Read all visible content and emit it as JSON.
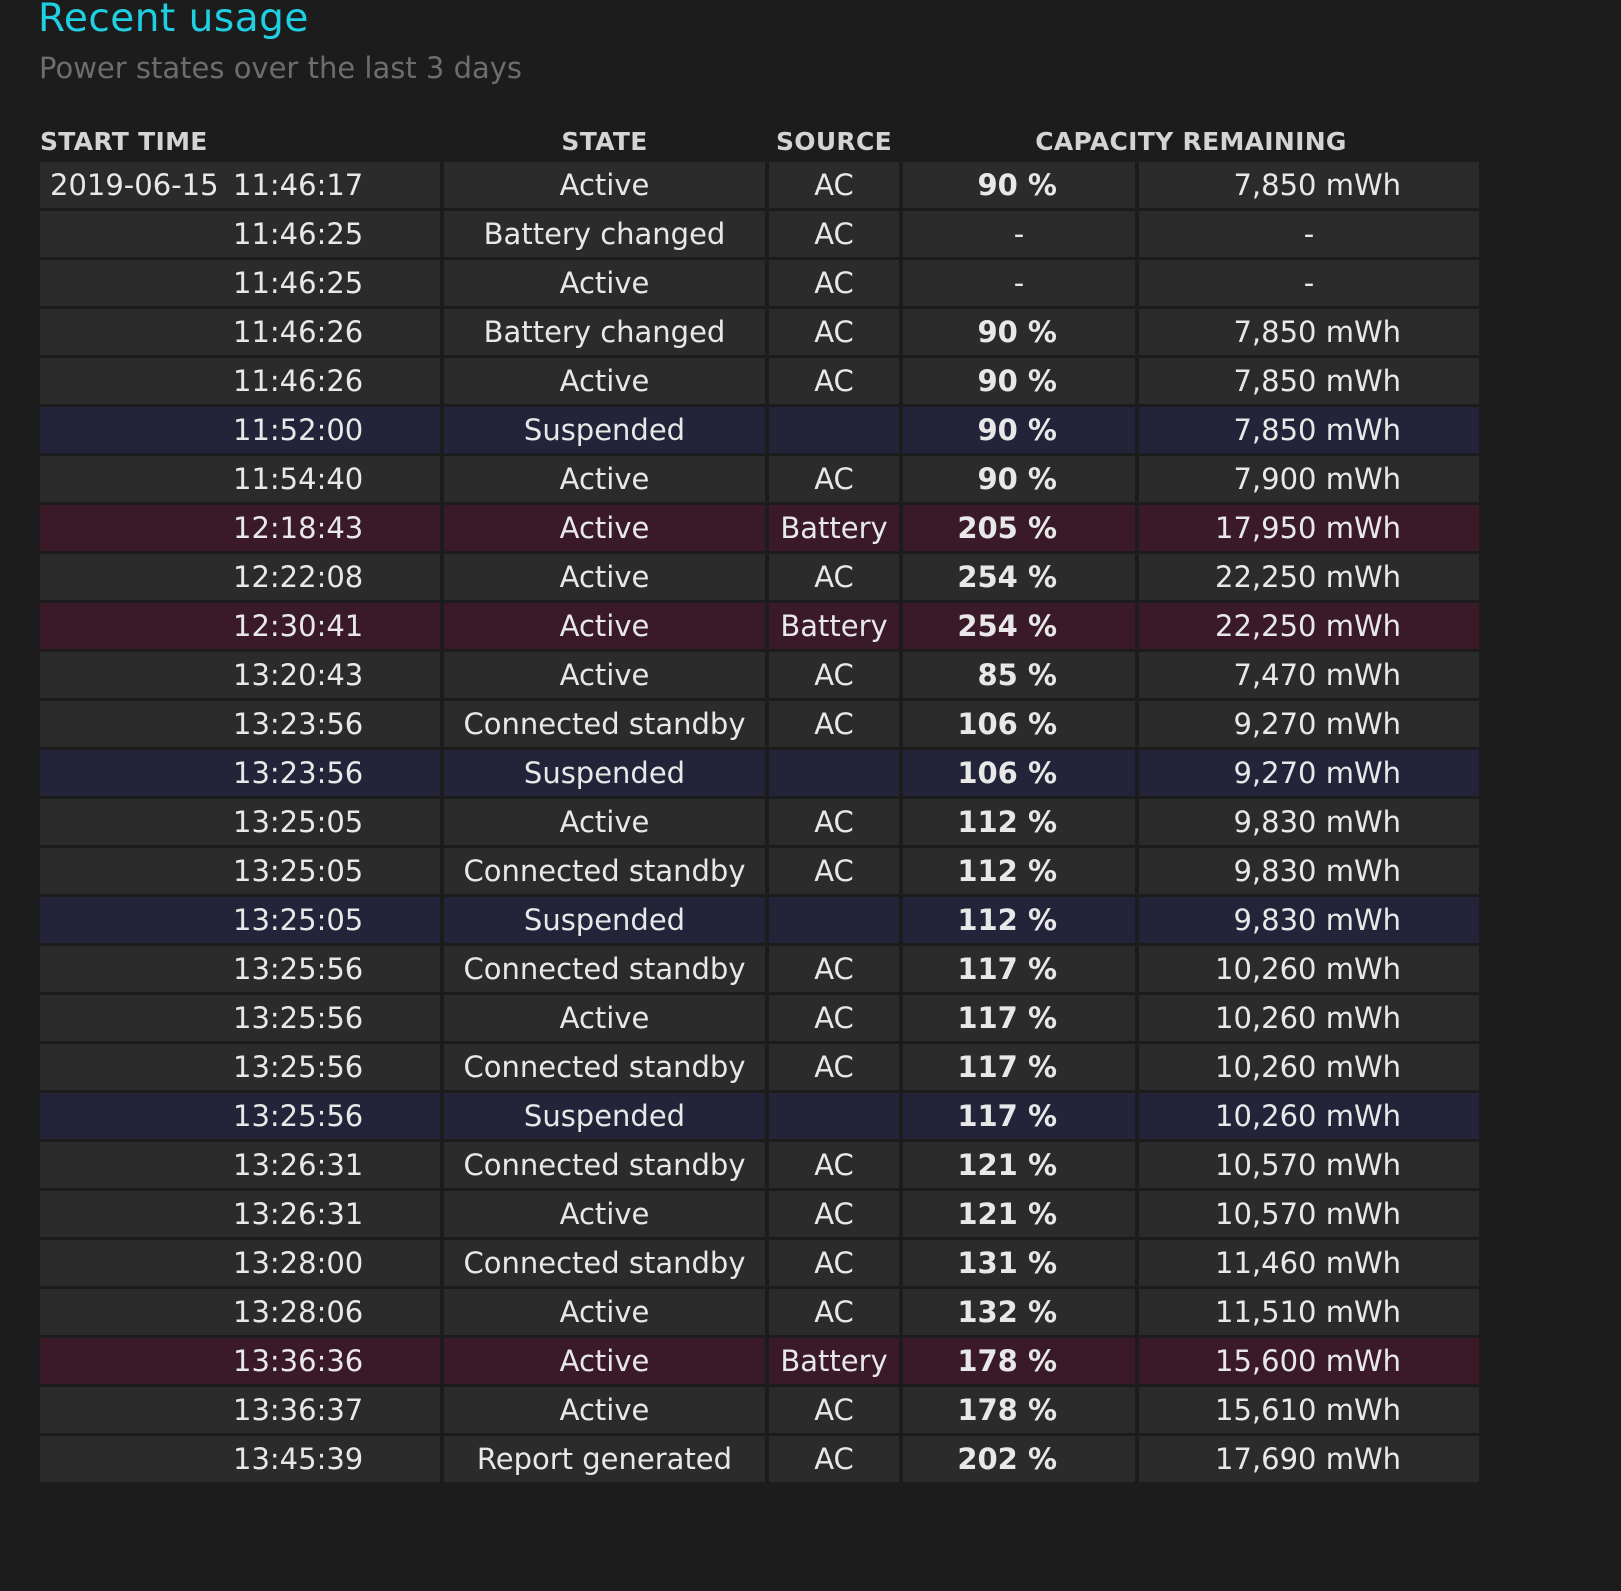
{
  "header": {
    "title": "Recent usage",
    "subtitle": "Power states over the last 3 days"
  },
  "table": {
    "columns": [
      "START TIME",
      "STATE",
      "SOURCE",
      "CAPACITY REMAINING"
    ],
    "rows": [
      {
        "date": "2019-06-15",
        "time": "11:46:17",
        "state": "Active",
        "source": "AC",
        "percent": "90 %",
        "capacity": "7,850 mWh"
      },
      {
        "date": "",
        "time": "11:46:25",
        "state": "Battery changed",
        "source": "AC",
        "percent": "-",
        "capacity": "-"
      },
      {
        "date": "",
        "time": "11:46:25",
        "state": "Active",
        "source": "AC",
        "percent": "-",
        "capacity": "-"
      },
      {
        "date": "",
        "time": "11:46:26",
        "state": "Battery changed",
        "source": "AC",
        "percent": "90 %",
        "capacity": "7,850 mWh"
      },
      {
        "date": "",
        "time": "11:46:26",
        "state": "Active",
        "source": "AC",
        "percent": "90 %",
        "capacity": "7,850 mWh"
      },
      {
        "date": "",
        "time": "11:52:00",
        "state": "Suspended",
        "source": "",
        "percent": "90 %",
        "capacity": "7,850 mWh"
      },
      {
        "date": "",
        "time": "11:54:40",
        "state": "Active",
        "source": "AC",
        "percent": "90 %",
        "capacity": "7,900 mWh"
      },
      {
        "date": "",
        "time": "12:18:43",
        "state": "Active",
        "source": "Battery",
        "percent": "205 %",
        "capacity": "17,950 mWh"
      },
      {
        "date": "",
        "time": "12:22:08",
        "state": "Active",
        "source": "AC",
        "percent": "254 %",
        "capacity": "22,250 mWh"
      },
      {
        "date": "",
        "time": "12:30:41",
        "state": "Active",
        "source": "Battery",
        "percent": "254 %",
        "capacity": "22,250 mWh"
      },
      {
        "date": "",
        "time": "13:20:43",
        "state": "Active",
        "source": "AC",
        "percent": "85 %",
        "capacity": "7,470 mWh"
      },
      {
        "date": "",
        "time": "13:23:56",
        "state": "Connected standby",
        "source": "AC",
        "percent": "106 %",
        "capacity": "9,270 mWh"
      },
      {
        "date": "",
        "time": "13:23:56",
        "state": "Suspended",
        "source": "",
        "percent": "106 %",
        "capacity": "9,270 mWh"
      },
      {
        "date": "",
        "time": "13:25:05",
        "state": "Active",
        "source": "AC",
        "percent": "112 %",
        "capacity": "9,830 mWh"
      },
      {
        "date": "",
        "time": "13:25:05",
        "state": "Connected standby",
        "source": "AC",
        "percent": "112 %",
        "capacity": "9,830 mWh"
      },
      {
        "date": "",
        "time": "13:25:05",
        "state": "Suspended",
        "source": "",
        "percent": "112 %",
        "capacity": "9,830 mWh"
      },
      {
        "date": "",
        "time": "13:25:56",
        "state": "Connected standby",
        "source": "AC",
        "percent": "117 %",
        "capacity": "10,260 mWh"
      },
      {
        "date": "",
        "time": "13:25:56",
        "state": "Active",
        "source": "AC",
        "percent": "117 %",
        "capacity": "10,260 mWh"
      },
      {
        "date": "",
        "time": "13:25:56",
        "state": "Connected standby",
        "source": "AC",
        "percent": "117 %",
        "capacity": "10,260 mWh"
      },
      {
        "date": "",
        "time": "13:25:56",
        "state": "Suspended",
        "source": "",
        "percent": "117 %",
        "capacity": "10,260 mWh"
      },
      {
        "date": "",
        "time": "13:26:31",
        "state": "Connected standby",
        "source": "AC",
        "percent": "121 %",
        "capacity": "10,570 mWh"
      },
      {
        "date": "",
        "time": "13:26:31",
        "state": "Active",
        "source": "AC",
        "percent": "121 %",
        "capacity": "10,570 mWh"
      },
      {
        "date": "",
        "time": "13:28:00",
        "state": "Connected standby",
        "source": "AC",
        "percent": "131 %",
        "capacity": "11,460 mWh"
      },
      {
        "date": "",
        "time": "13:28:06",
        "state": "Active",
        "source": "AC",
        "percent": "132 %",
        "capacity": "11,510 mWh"
      },
      {
        "date": "",
        "time": "13:36:36",
        "state": "Active",
        "source": "Battery",
        "percent": "178 %",
        "capacity": "15,600 mWh"
      },
      {
        "date": "",
        "time": "13:36:37",
        "state": "Active",
        "source": "AC",
        "percent": "178 %",
        "capacity": "15,610 mWh"
      },
      {
        "date": "",
        "time": "13:45:39",
        "state": "Report generated",
        "source": "AC",
        "percent": "202 %",
        "capacity": "17,690 mWh"
      }
    ]
  },
  "colors": {
    "title": "#1fd0e2",
    "row_default": "#2b2b2b",
    "row_suspended": "#23233a",
    "row_battery": "#3a1a28"
  }
}
